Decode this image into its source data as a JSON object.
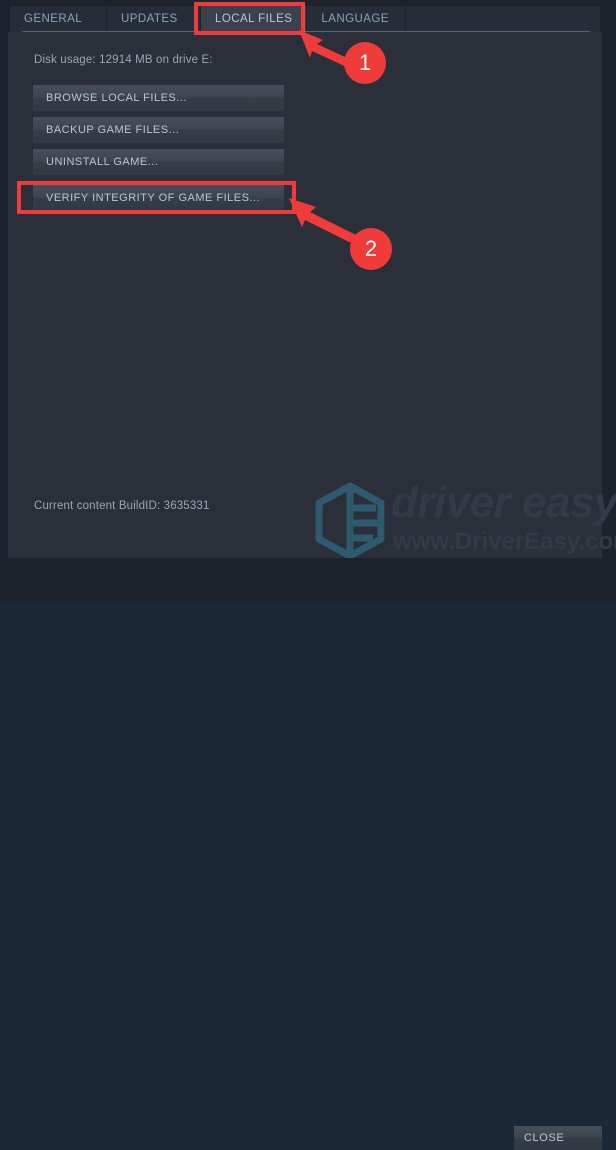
{
  "tabs": [
    {
      "label": "GENERAL",
      "active": false
    },
    {
      "label": "UPDATES",
      "active": false
    },
    {
      "label": "LOCAL FILES",
      "active": true
    },
    {
      "label": "LANGUAGE",
      "active": false
    }
  ],
  "content": {
    "disk_usage": "Disk usage: 12914 MB on drive E:",
    "buttons": [
      {
        "label": "BROWSE LOCAL FILES..."
      },
      {
        "label": "BACKUP GAME FILES..."
      },
      {
        "label": "UNINSTALL GAME..."
      },
      {
        "label": "VERIFY INTEGRITY OF GAME FILES..."
      }
    ],
    "build_id": "Current content BuildID: 3635331"
  },
  "annotations": {
    "badges": [
      {
        "number": "1",
        "target": "local-files-tab"
      },
      {
        "number": "2",
        "target": "verify-integrity-button"
      }
    ],
    "highlight_color": "#f03b3b"
  },
  "watermark": {
    "title": "driver easy",
    "url": "www.DriverEasy.com",
    "logo_icon": "hexagon-logo-icon",
    "color": "#333a47"
  },
  "footer": {
    "close_label": "CLOSE"
  },
  "colors": {
    "window_bg": "#1d222b",
    "panel_bg": "#2a2f3a",
    "tab_bg": "#272d38",
    "tab_active_bg": "#3a414d",
    "text": "#9aa7b4",
    "button_text": "#b8c6d4",
    "accent_red": "#f03b3b"
  }
}
